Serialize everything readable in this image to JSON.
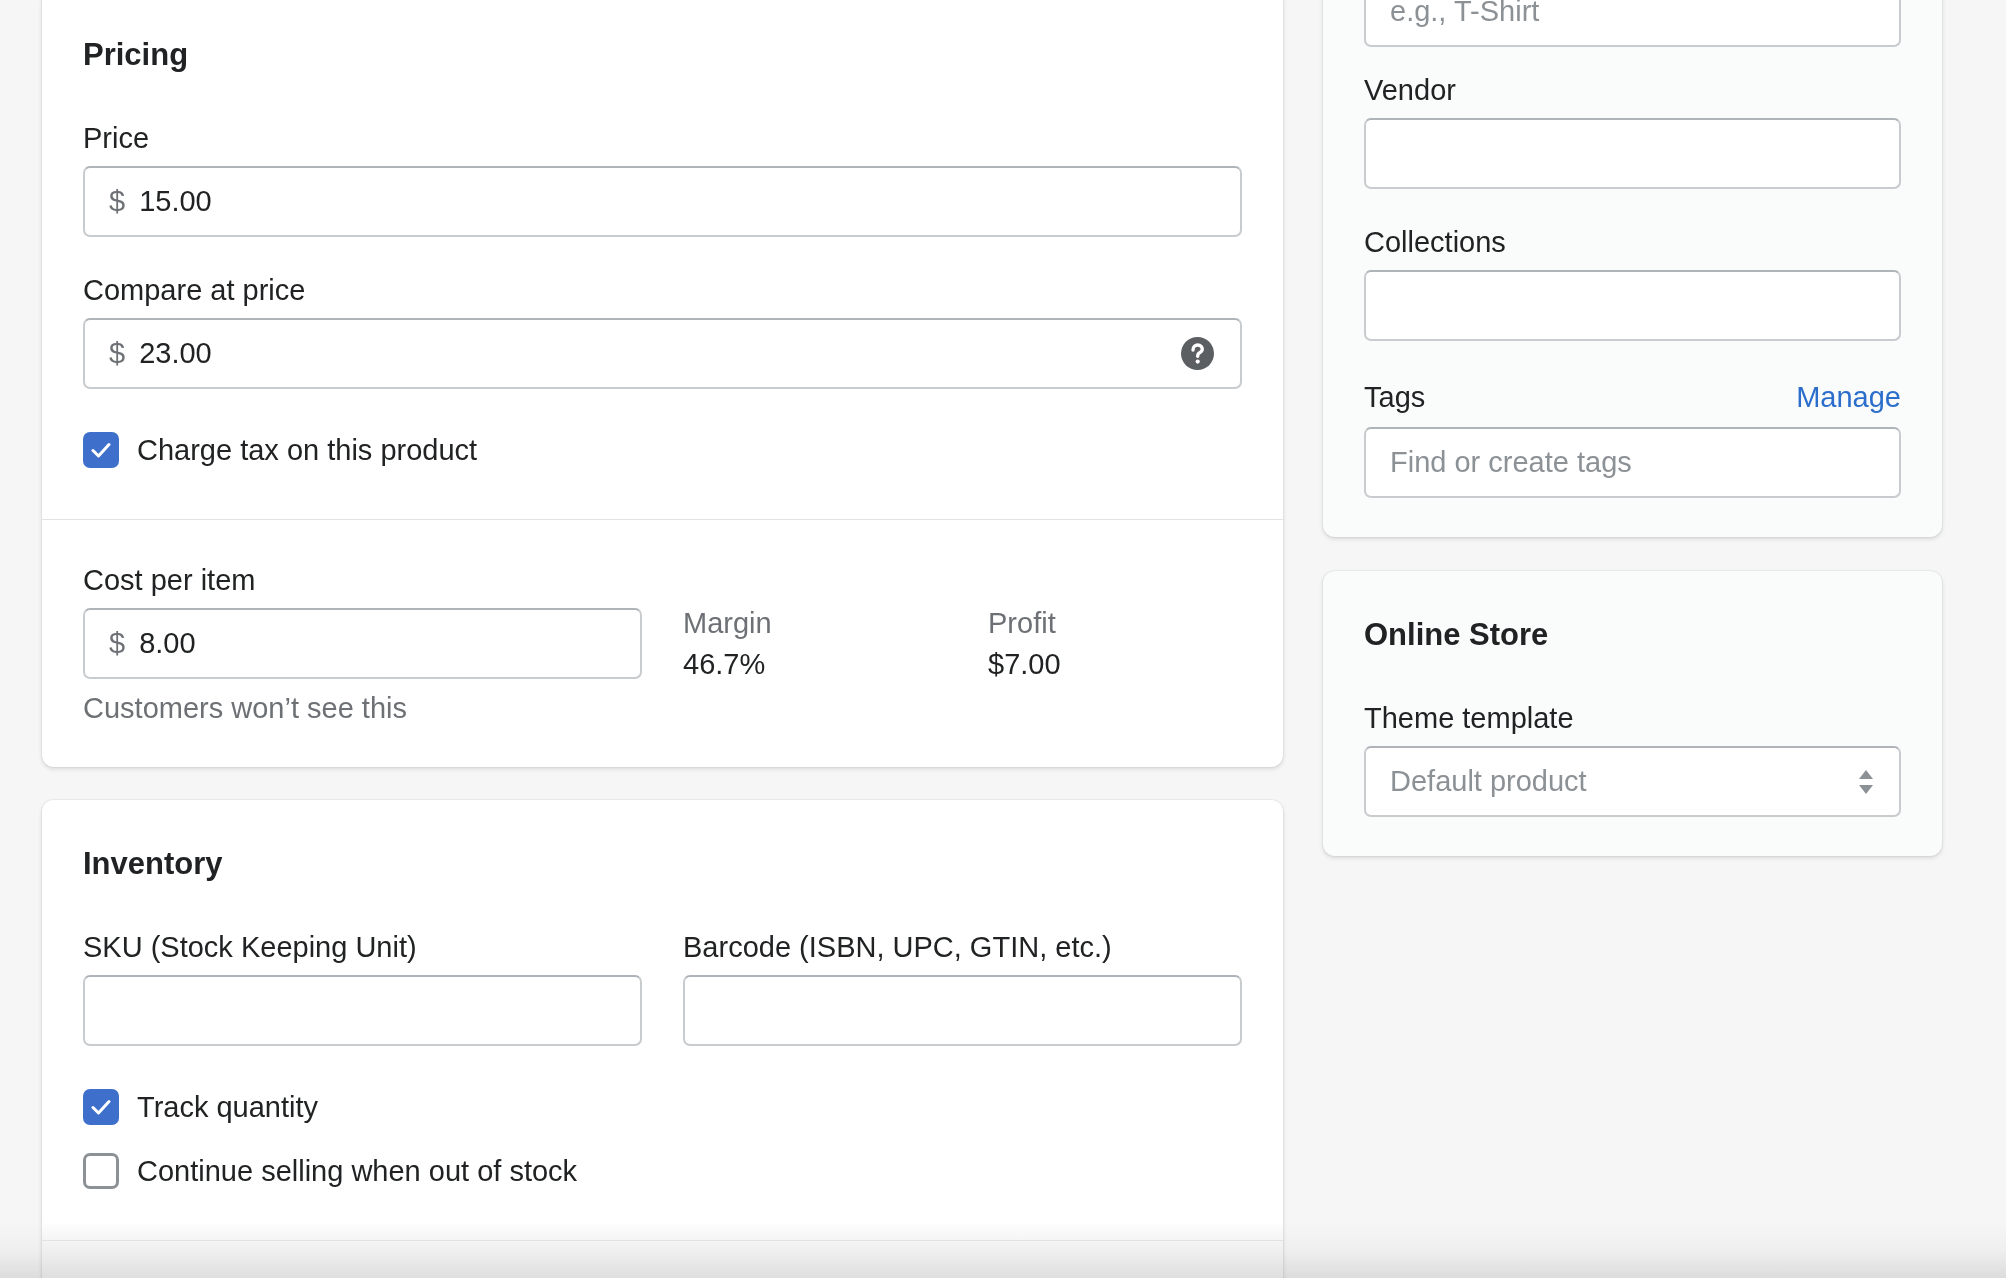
{
  "pricing": {
    "title": "Pricing",
    "price": {
      "label": "Price",
      "prefix": "$",
      "value": "15.00"
    },
    "compare_at_price": {
      "label": "Compare at price",
      "prefix": "$",
      "value": "23.00"
    },
    "charge_tax": {
      "label": "Charge tax on this product",
      "checked": true
    },
    "cost_per_item": {
      "label": "Cost per item",
      "prefix": "$",
      "value": "8.00",
      "help_text": "Customers won’t see this"
    },
    "margin": {
      "label": "Margin",
      "value": "46.7%"
    },
    "profit": {
      "label": "Profit",
      "value": "$7.00"
    }
  },
  "inventory": {
    "title": "Inventory",
    "sku": {
      "label": "SKU (Stock Keeping Unit)"
    },
    "barcode": {
      "label": "Barcode (ISBN, UPC, GTIN, etc.)"
    },
    "options": [
      {
        "label": "Track quantity",
        "checked": true
      },
      {
        "label": "Continue selling when out of stock",
        "checked": false
      }
    ]
  },
  "organization": {
    "product_type": {
      "placeholder": "e.g., T-Shirt"
    },
    "vendor": {
      "label": "Vendor"
    },
    "collections": {
      "label": "Collections"
    },
    "tags": {
      "label": "Tags",
      "link": "Manage",
      "placeholder": "Find or create tags"
    }
  },
  "online_store": {
    "title": "Online Store",
    "theme_template": {
      "label": "Theme template",
      "placeholder": "Default product"
    }
  }
}
